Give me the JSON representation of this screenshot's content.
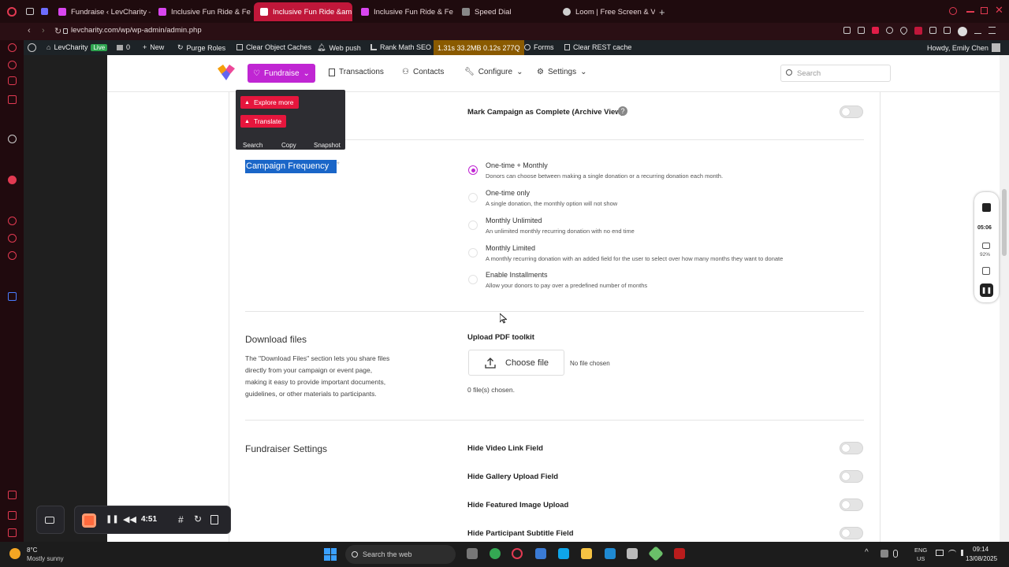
{
  "browser": {
    "tabs": [
      {
        "label": "Fundraise ‹ LevCharity —"
      },
      {
        "label": "Inclusive Fun Ride & Festi"
      },
      {
        "label": "Inclusive Fun Ride &amp;"
      },
      {
        "label": "Inclusive Fun Ride & Festi"
      },
      {
        "label": "Speed Dial"
      },
      {
        "label": "Loom | Free Screen & Vid"
      }
    ],
    "url": "levcharity.com/wp/wp-admin/admin.php"
  },
  "wpbar": {
    "site": "LevCharity",
    "live_badge": "Live",
    "comments": "0",
    "new": "New",
    "purge": "Purge Roles",
    "clear_cache": "Clear Object Caches",
    "webpush": "Web push",
    "rankmath": "Rank Math SEO",
    "perf": "1.31s  33.2MB  0.12s  277Q",
    "forms": "Forms",
    "clear_rest": "Clear REST cache",
    "howdy": "Howdy, Emily Chen"
  },
  "appnav": {
    "fundraise": "Fundraise",
    "transactions": "Transactions",
    "contacts": "Contacts",
    "configure": "Configure",
    "settings": "Settings",
    "search_placeholder": "Search"
  },
  "popup": {
    "explore": "Explore more",
    "translate": "Translate",
    "search": "Search",
    "copy": "Copy",
    "snapshot": "Snapshot"
  },
  "archive": {
    "label": "Mark Campaign as Complete (Archive View)"
  },
  "frequency": {
    "title": "Campaign Frequency",
    "asterisk": "*",
    "options": [
      {
        "title": "One-time + Monthly",
        "desc": "Donors can choose between making a single donation or a recurring donation each month."
      },
      {
        "title": "One-time only",
        "desc": "A single donation, the monthly option will not show"
      },
      {
        "title": "Monthly Unlimited",
        "desc": "An unlimited monthly recurring donation with no end time"
      },
      {
        "title": "Monthly Limited",
        "desc": "A monthly recurring donation with an added field for the user to select over how many months they want to donate"
      },
      {
        "title": "Enable Installments",
        "desc": "Allow your donors to pay over a predefined number of months"
      }
    ],
    "selected": "One-time + Monthly"
  },
  "download": {
    "title": "Download files",
    "desc_lines": [
      "The \"Download Files\" section lets you share files",
      "directly from your campaign or event page,",
      "making it easy to provide important documents,",
      "guidelines, or other materials to participants."
    ],
    "upload_label": "Upload PDF toolkit",
    "choose": "Choose file",
    "no_file": "No file chosen",
    "chosen": "0 file(s) chosen."
  },
  "fundraiser": {
    "title": "Fundraiser Settings",
    "toggles": [
      {
        "label": "Hide Video Link Field",
        "on": false
      },
      {
        "label": "Hide Gallery Upload Field",
        "on": false
      },
      {
        "label": "Hide Featured Image Upload",
        "on": false
      },
      {
        "label": "Hide Participant Subtitle Field",
        "on": false
      }
    ]
  },
  "recorder": {
    "time": "4:51"
  },
  "loom": {
    "time": "05:06",
    "pct": "92%"
  },
  "taskbar": {
    "weather_temp": "8°C",
    "weather_desc": "Mostly sunny",
    "search": "Search the web",
    "lang1": "ENG",
    "lang2": "US",
    "time": "09:14",
    "date": "13/08/2025"
  },
  "colors": {
    "accent": "#c026d3",
    "tab_active": "#c0173a",
    "highlight": "#1a66c8"
  }
}
